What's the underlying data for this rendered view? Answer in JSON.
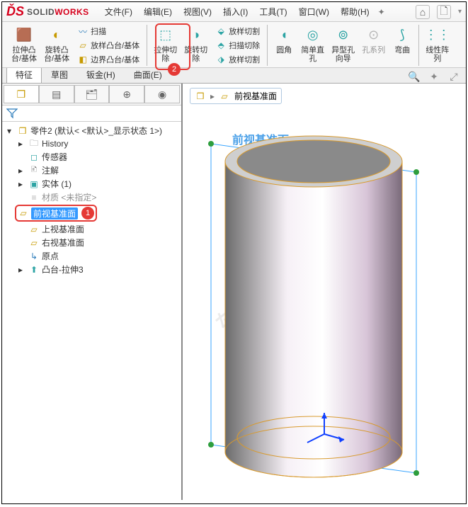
{
  "app": {
    "name_solid": "SOLID",
    "name_works": "WORKS"
  },
  "menus": {
    "file": "文件(F)",
    "edit": "编辑(E)",
    "view": "视图(V)",
    "insert": "插入(I)",
    "tools": "工具(T)",
    "window": "窗口(W)",
    "help": "帮助(H)"
  },
  "ribbon": {
    "g1": {
      "extrude": "拉伸凸\n台/基体",
      "revolve": "旋转凸\n台/基体",
      "sweep": "扫描",
      "loft": "放样凸台/基体",
      "boundary": "边界凸台/基体"
    },
    "g2": {
      "cut_extrude": "拉伸切\n除",
      "cut_revolve": "旋转切\n除",
      "cut_sweep": "放样切割",
      "cut_loft": "扫描切除",
      "cut_boundary": "放样切割"
    },
    "g3": {
      "fillet": "圆角",
      "hole_simple": "简单直\n孔",
      "hole_wizard": "异型孔\n向导",
      "hole_series": "孔系列",
      "bend": "弯曲"
    },
    "g4": {
      "linear": "线性阵\n列"
    }
  },
  "tabs": {
    "feature": "特征",
    "sketch": "草图",
    "sheetmetal": "钣金(H)",
    "surface": "曲面(E)"
  },
  "tree": {
    "root": "零件2  (默认< <默认>_显示状态 1>)",
    "history": "History",
    "sensors": "传感器",
    "annotations": "注解",
    "bodies": "实体 (1)",
    "material": "材质 <未指定>",
    "front": "前视基准面",
    "top": "上视基准面",
    "right": "右视基准面",
    "origin": "原点",
    "feat1": "凸台-拉伸3"
  },
  "breadcrumb": {
    "label": "前视基准面"
  },
  "viewport": {
    "plane_label": "前视基准面"
  },
  "annotations": {
    "badge1": "1",
    "badge2": "2"
  },
  "watermark": "软件自学网"
}
